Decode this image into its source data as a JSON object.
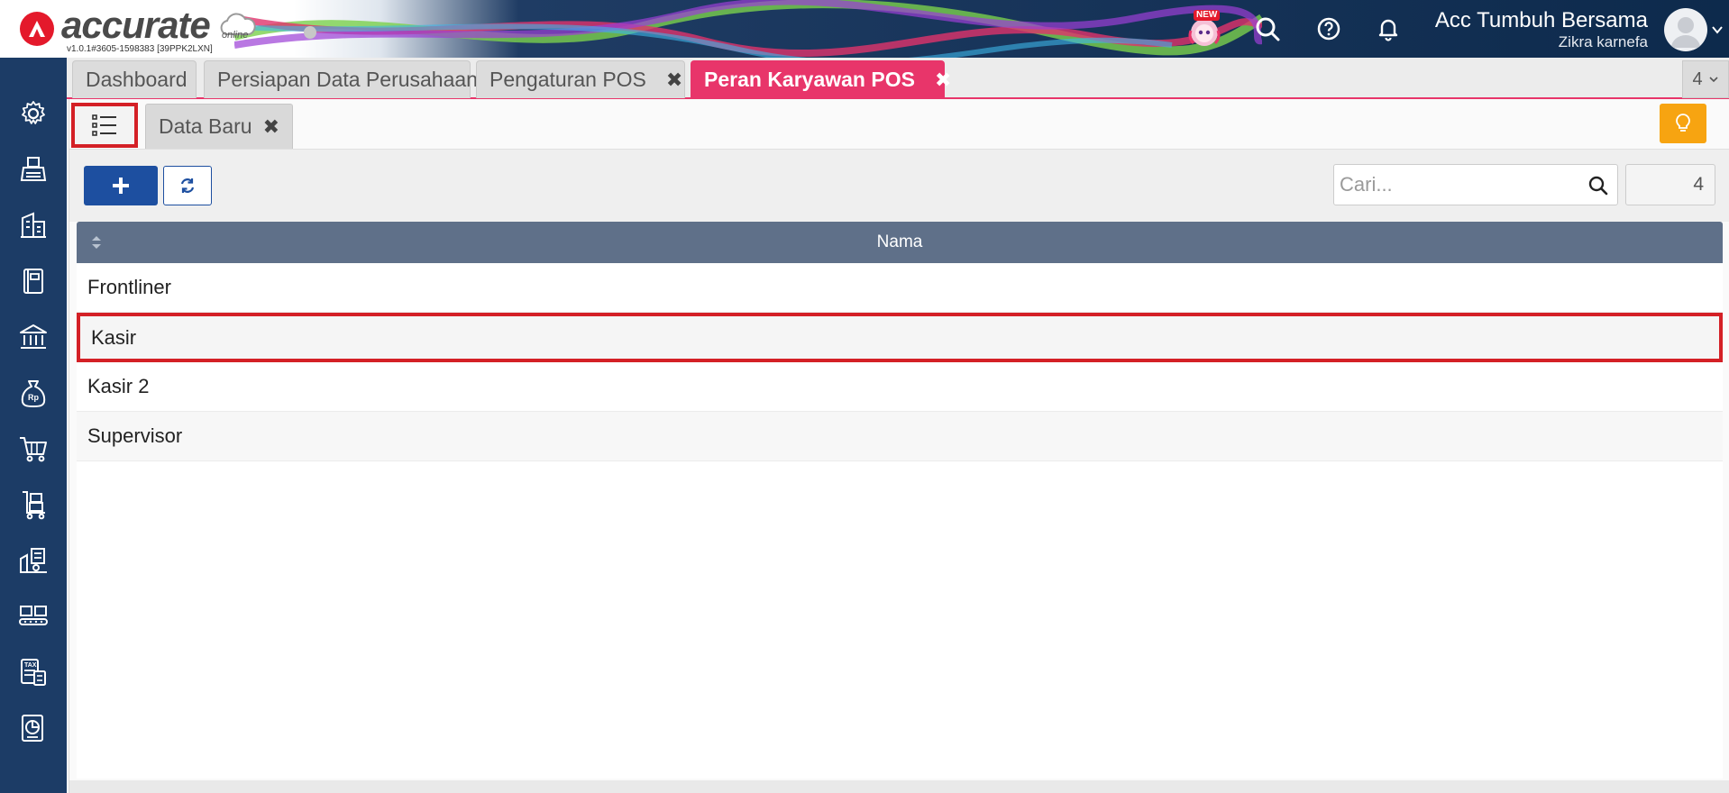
{
  "header": {
    "logo_text": "accurate",
    "logo_sub": "online",
    "version": "v1.0.1#3605-1598383 [39PPK2LXN]",
    "new_badge": "NEW",
    "company_name": "Acc Tumbuh Bersama",
    "user_name": "Zikra karnefa"
  },
  "sidebar": {
    "items": [
      {
        "icon": "gear-icon"
      },
      {
        "icon": "fax-machine-icon"
      },
      {
        "icon": "company-buildings-icon"
      },
      {
        "icon": "ledger-book-icon"
      },
      {
        "icon": "bank-icon"
      },
      {
        "icon": "money-bag-rp-icon"
      },
      {
        "icon": "shopping-cart-icon"
      },
      {
        "icon": "hand-truck-icon"
      },
      {
        "icon": "factory-icon"
      },
      {
        "icon": "warehouse-icon"
      },
      {
        "icon": "tax-calculator-icon"
      },
      {
        "icon": "pie-report-icon"
      }
    ]
  },
  "tabs": {
    "items": [
      {
        "label": "Dashboard"
      },
      {
        "label": "Persiapan Data Perusahaan"
      },
      {
        "label": "Pengaturan POS"
      },
      {
        "label": "Peran Karyawan POS"
      }
    ],
    "count": "4"
  },
  "subtabs": {
    "data_baru": "Data Baru"
  },
  "toolbar": {
    "search_placeholder": "Cari...",
    "record_count": "4"
  },
  "table": {
    "column": "Nama",
    "rows": [
      "Frontliner",
      "Kasir",
      "Kasir 2",
      "Supervisor"
    ]
  },
  "colors": {
    "sidebar": "#1c3c66",
    "active_tab": "#e8356a",
    "primary_button": "#1d4fa0",
    "table_header": "#5f7089",
    "highlight_border": "#d42026",
    "tip_button": "#f7a411"
  }
}
